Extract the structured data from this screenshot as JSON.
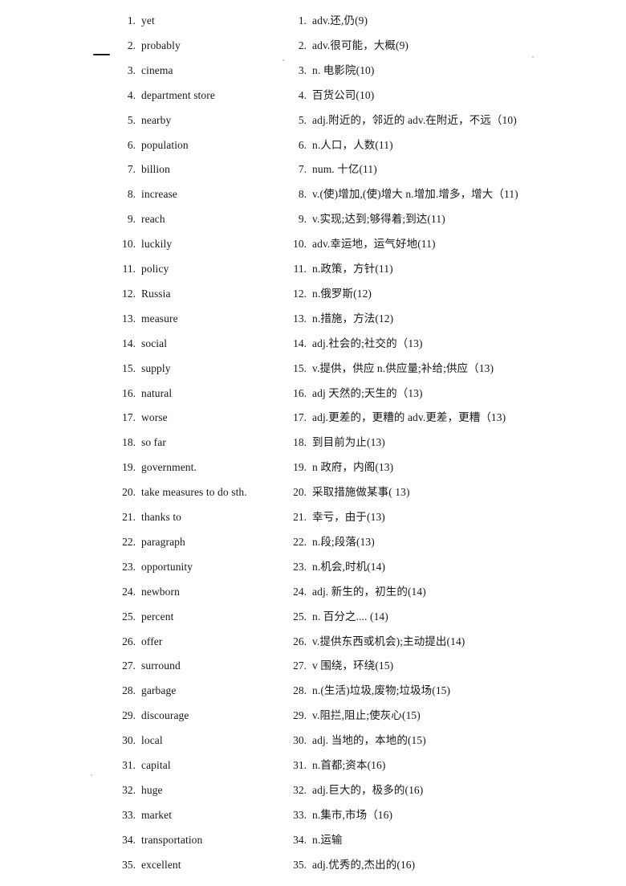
{
  "page": {
    "background_color": "#ffffff",
    "text_color": "#17181a",
    "margin_mark": "dash"
  },
  "entries": [
    {
      "num_en": "1.",
      "term": "yet",
      "num_zh": "1.",
      "gloss": "adv.还,仍(9)"
    },
    {
      "num_en": "2.",
      "term": "probably",
      "num_zh": "2.",
      "gloss": "adv.很可能，大概(9)"
    },
    {
      "num_en": "3.",
      "term": "cinema",
      "num_zh": "3.",
      "gloss": "n. 电影院(10)"
    },
    {
      "num_en": "4.",
      "term": "department store",
      "num_zh": "4.",
      "gloss": "百货公司(10)"
    },
    {
      "num_en": "5.",
      "term": "nearby",
      "num_zh": "5.",
      "gloss": "adj.附近的，邻近的 adv.在附近，不远（10)"
    },
    {
      "num_en": "6.",
      "term": "population",
      "num_zh": "6.",
      "gloss": "n.人口，人数(11)"
    },
    {
      "num_en": "7.",
      "term": "billion",
      "num_zh": "7.",
      "gloss": "num. 十亿(11)"
    },
    {
      "num_en": "8.",
      "term": "increase",
      "num_zh": "8.",
      "gloss": "v.(使)增加,(使)增大 n.增加.增多，增大（11)"
    },
    {
      "num_en": "9.",
      "term": "reach",
      "num_zh": "9.",
      "gloss": "v.实现;达到;够得着;到达(11)"
    },
    {
      "num_en": "10.",
      "term": "luckily",
      "num_zh": "10.",
      "gloss": "adv.幸运地，运气好地(11)"
    },
    {
      "num_en": "11.",
      "term": "policy",
      "num_zh": "11.",
      "gloss": "n.政策，方针(11)"
    },
    {
      "num_en": "12.",
      "term": "Russia",
      "num_zh": "12.",
      "gloss": "n.俄罗斯(12)"
    },
    {
      "num_en": "13.",
      "term": "measure",
      "num_zh": "13.",
      "gloss": "n.措施，方法(12)"
    },
    {
      "num_en": "14.",
      "term": "social",
      "num_zh": "14.",
      "gloss": "adj.社会的;社交的（13)"
    },
    {
      "num_en": "15.",
      "term": "supply",
      "num_zh": "15.",
      "gloss": "v.提供，供应 n.供应量;补给;供应（13)"
    },
    {
      "num_en": "16.",
      "term": "natural",
      "num_zh": "16.",
      "gloss": "adj 天然的;天生的（13)"
    },
    {
      "num_en": "17.",
      "term": "worse",
      "num_zh": "17.",
      "gloss": "adj.更差的，更糟的 adv.更差，更糟（13)"
    },
    {
      "num_en": "18.",
      "term": "so far",
      "num_zh": "18.",
      "gloss": "到目前为止(13)"
    },
    {
      "num_en": "19.",
      "term": "government.",
      "num_zh": "19.",
      "gloss": "n 政府，内阁(13)"
    },
    {
      "num_en": "20.",
      "term": "take measures to do sth.",
      "num_zh": "20.",
      "gloss": "采取措施做某事( 13)"
    },
    {
      "num_en": "21.",
      "term": "thanks to",
      "num_zh": "21.",
      "gloss": "幸亏，由于(13)"
    },
    {
      "num_en": "22.",
      "term": "paragraph",
      "num_zh": "22.",
      "gloss": "n.段;段落(13)"
    },
    {
      "num_en": "23.",
      "term": "opportunity",
      "num_zh": "23.",
      "gloss": "n.机会,时机(14)"
    },
    {
      "num_en": "24.",
      "term": "newborn",
      "num_zh": "24.",
      "gloss": "adj. 新生的，初生的(14)"
    },
    {
      "num_en": "25.",
      "term": "percent",
      "num_zh": "25.",
      "gloss": "n. 百分之.... (14)"
    },
    {
      "num_en": "26.",
      "term": "offer",
      "num_zh": "26.",
      "gloss": "v.提供东西或机会);主动提出(14)"
    },
    {
      "num_en": "27.",
      "term": "surround",
      "num_zh": "27.",
      "gloss": "v 围绕，环绕(15)"
    },
    {
      "num_en": "28.",
      "term": "garbage",
      "num_zh": "28.",
      "gloss": "n.(生活)垃圾,废物;垃圾场(15)"
    },
    {
      "num_en": "29.",
      "term": "discourage",
      "num_zh": "29.",
      "gloss": "v.阻拦,阻止;使灰心(15)"
    },
    {
      "num_en": "30.",
      "term": "local",
      "num_zh": "30.",
      "gloss": "adj. 当地的，本地的(15)"
    },
    {
      "num_en": "31.",
      "term": "capital",
      "num_zh": "31.",
      "gloss": "n.首都;资本(16)"
    },
    {
      "num_en": "32.",
      "term": "huge",
      "num_zh": "32.",
      "gloss": "adj.巨大的，极多的(16)"
    },
    {
      "num_en": "33.",
      "term": "market",
      "num_zh": "33.",
      "gloss": "n.集市,市场（16)"
    },
    {
      "num_en": "34.",
      "term": "transportation",
      "num_zh": "34.",
      "gloss": "n.运输"
    },
    {
      "num_en": "35.",
      "term": "excellent",
      "num_zh": "35.",
      "gloss": "adj.优秀的,杰出的(16)"
    }
  ]
}
